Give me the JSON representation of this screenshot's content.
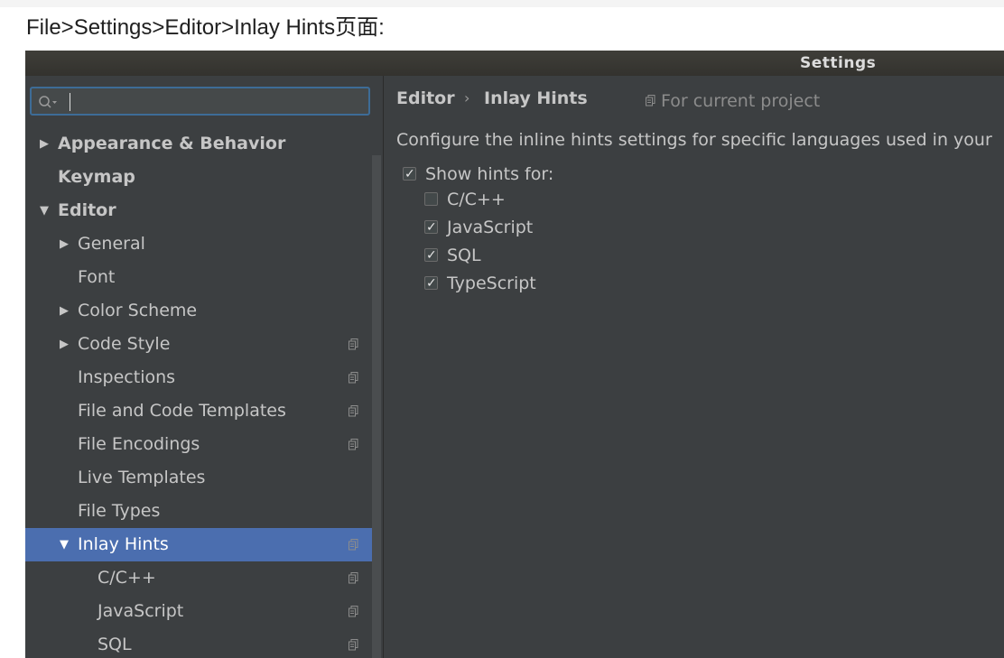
{
  "caption": "File>Settings>Editor>Inlay Hints页面:",
  "window": {
    "title": "Settings"
  },
  "search": {
    "value": "",
    "placeholder": ""
  },
  "tree": [
    {
      "label": "Appearance & Behavior",
      "expander": "▶",
      "bold": true
    },
    {
      "label": "Keymap",
      "bold": true
    },
    {
      "label": "Editor",
      "expander": "▼",
      "bold": true
    },
    {
      "label": "General",
      "expander": "▶"
    },
    {
      "label": "Font"
    },
    {
      "label": "Color Scheme",
      "expander": "▶"
    },
    {
      "label": "Code Style",
      "expander": "▶",
      "project_icon": "copy-icon"
    },
    {
      "label": "Inspections",
      "project_icon": "copy-icon"
    },
    {
      "label": "File and Code Templates",
      "project_icon": "copy-icon"
    },
    {
      "label": "File Encodings",
      "project_icon": "copy-icon"
    },
    {
      "label": "Live Templates"
    },
    {
      "label": "File Types"
    },
    {
      "label": "Inlay Hints",
      "expander": "▼",
      "project_icon": "copy-icon",
      "selected": true
    },
    {
      "label": "C/C++",
      "project_icon": "copy-icon"
    },
    {
      "label": "JavaScript",
      "project_icon": "copy-icon"
    },
    {
      "label": "SQL",
      "project_icon": "copy-icon"
    }
  ],
  "content": {
    "breadcrumb": [
      "Editor",
      "Inlay Hints"
    ],
    "breadcrumb_separator": "›",
    "for_current_project": "For current project",
    "description": "Configure the inline hints settings for specific languages used in your",
    "show_hints": {
      "label": "Show hints for:",
      "checked": true
    },
    "languages": [
      {
        "label": "C/C++",
        "checked": false
      },
      {
        "label": "JavaScript",
        "checked": true
      },
      {
        "label": "SQL",
        "checked": true
      },
      {
        "label": "TypeScript",
        "checked": true
      }
    ]
  },
  "colors": {
    "panel": "#3c3f41",
    "selection": "#4b6eaf",
    "search_border": "#3d6c97",
    "text": "#c6c6c6"
  }
}
